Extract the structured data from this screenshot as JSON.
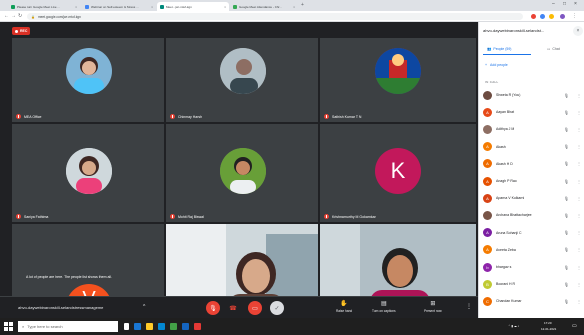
{
  "browser": {
    "tabs": [
      {
        "title": "Please turn Google Meet Live ...",
        "color": "#0f9d58"
      },
      {
        "title": "Webinar on Self-esteem & Stress ...",
        "color": "#4285f4"
      },
      {
        "title": "Meet - jwr-mtuf-kgn",
        "color": "#00897b",
        "active": true
      },
      {
        "title": "Google Meet Attendance - Chr...",
        "color": "#34a853"
      }
    ],
    "url": "meet.google.com/jwr-mtuf-kgn"
  },
  "meet": {
    "rec_label": "REC",
    "participants_grid": [
      {
        "name": "MEA Office",
        "avatar_color": "#7fb3d5"
      },
      {
        "name": "Chinmay Harsh",
        "avatar_color": "#8a8a8a"
      },
      {
        "name": "Sathish Kumar T N",
        "avatar_color": "#b23a48"
      },
      {
        "name": "Saniya Fathima",
        "avatar_color": "#a7a7a7"
      },
      {
        "name": "Mohit Raj Biswal",
        "avatar_color": "#6b8e5a"
      },
      {
        "name": "Krishnamurthy M Gokarnkar",
        "initial": "K",
        "avatar_color": "#c2185b"
      }
    ],
    "notice": "A lot of people are here. The people list shows them all.",
    "last_initial": "V",
    "title": "ahvo-daywebinaronskill-selandstressmanageme",
    "controls": {
      "raise_hand": "Raise hand",
      "captions": "Turn on captions",
      "present": "Present now"
    }
  },
  "panel": {
    "title": "ahvo-daywebinaronskill-selandst...",
    "tab_people": "People (59)",
    "tab_chat": "Chat",
    "add_people": "Add people",
    "section_label": "IN CALL",
    "people": [
      {
        "name": "Shweta R (You)",
        "color": "#6d4c41",
        "initial": ""
      },
      {
        "name": "Aayan Bhat",
        "color": "#e64a19",
        "initial": "A"
      },
      {
        "name": "Adithya J M",
        "color": "#8d6e63",
        "initial": ""
      },
      {
        "name": "Akash",
        "color": "#f57c00",
        "initial": "A"
      },
      {
        "name": "Akash H D",
        "color": "#ef6c00",
        "initial": "A"
      },
      {
        "name": "Anagh P Rao",
        "color": "#e65100",
        "initial": "A"
      },
      {
        "name": "Aparna V Kulkarni",
        "color": "#d84315",
        "initial": "A"
      },
      {
        "name": "Archana Bhattacharjee",
        "color": "#795548",
        "initial": ""
      },
      {
        "name": "Aruna Sohanji C",
        "color": "#7b1fa2",
        "initial": "A"
      },
      {
        "name": "Aveeta Zeba",
        "color": "#f57c00",
        "initial": "A"
      },
      {
        "name": "bhargav s",
        "color": "#8e24aa",
        "initial": "b"
      },
      {
        "name": "Boorani H R",
        "color": "#c0ca33",
        "initial": "B"
      },
      {
        "name": "Chandan Kumar",
        "color": "#ef6c00",
        "initial": "C"
      }
    ]
  },
  "taskbar": {
    "search_placeholder": "Type here to search",
    "time": "17:20",
    "date": "12-01-2021"
  }
}
